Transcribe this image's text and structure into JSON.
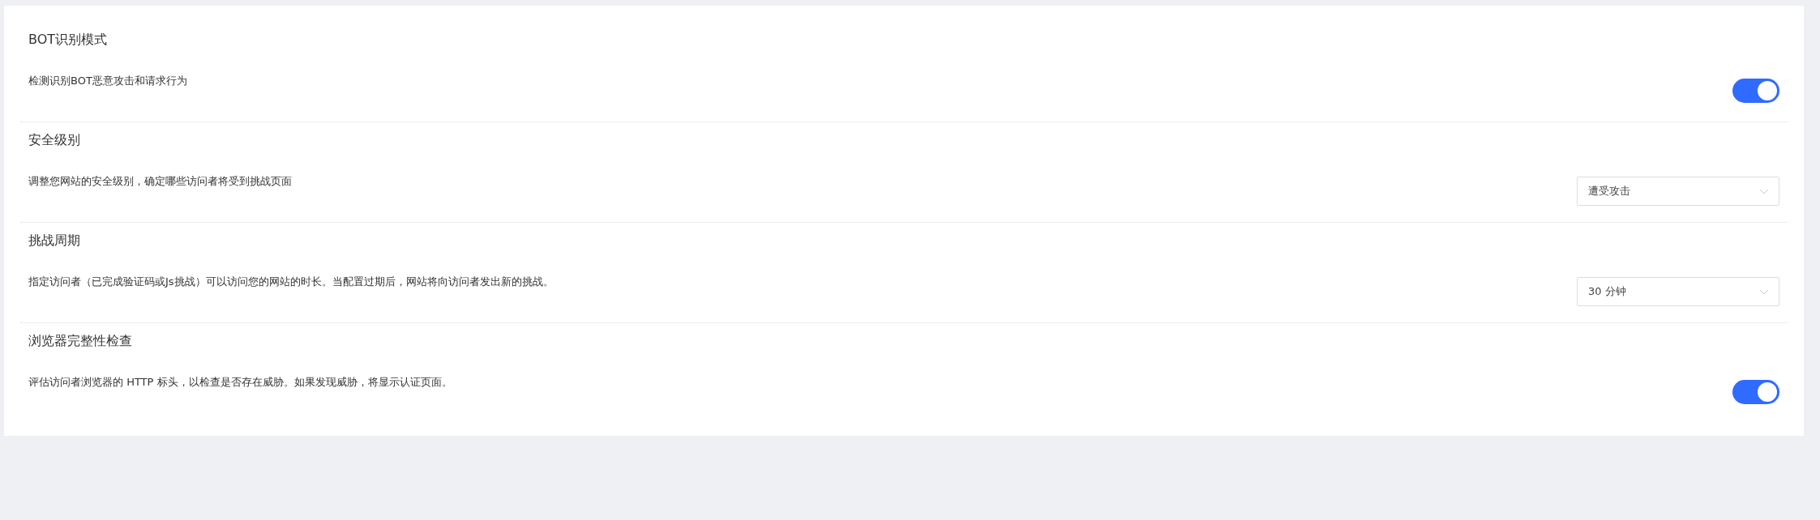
{
  "settings": [
    {
      "kind": "toggle",
      "title": "BOT识别模式",
      "description": "检测识别BOT恶意攻击和请求行为",
      "on": true
    },
    {
      "kind": "select",
      "title": "安全级别",
      "description": "调整您网站的安全级别，确定哪些访问者将受到挑战页面",
      "value": "遭受攻击"
    },
    {
      "kind": "select",
      "title": "挑战周期",
      "description": "指定访问者（已完成验证码或Js挑战）可以访问您的网站的时长。当配置过期后，网站将向访问者发出新的挑战。",
      "value": "30 分钟"
    },
    {
      "kind": "toggle",
      "title": "浏览器完整性检查",
      "description": "评估访问者浏览器的 HTTP 标头，以检查是否存在威胁。如果发现威胁，将显示认证页面。",
      "on": true
    }
  ]
}
